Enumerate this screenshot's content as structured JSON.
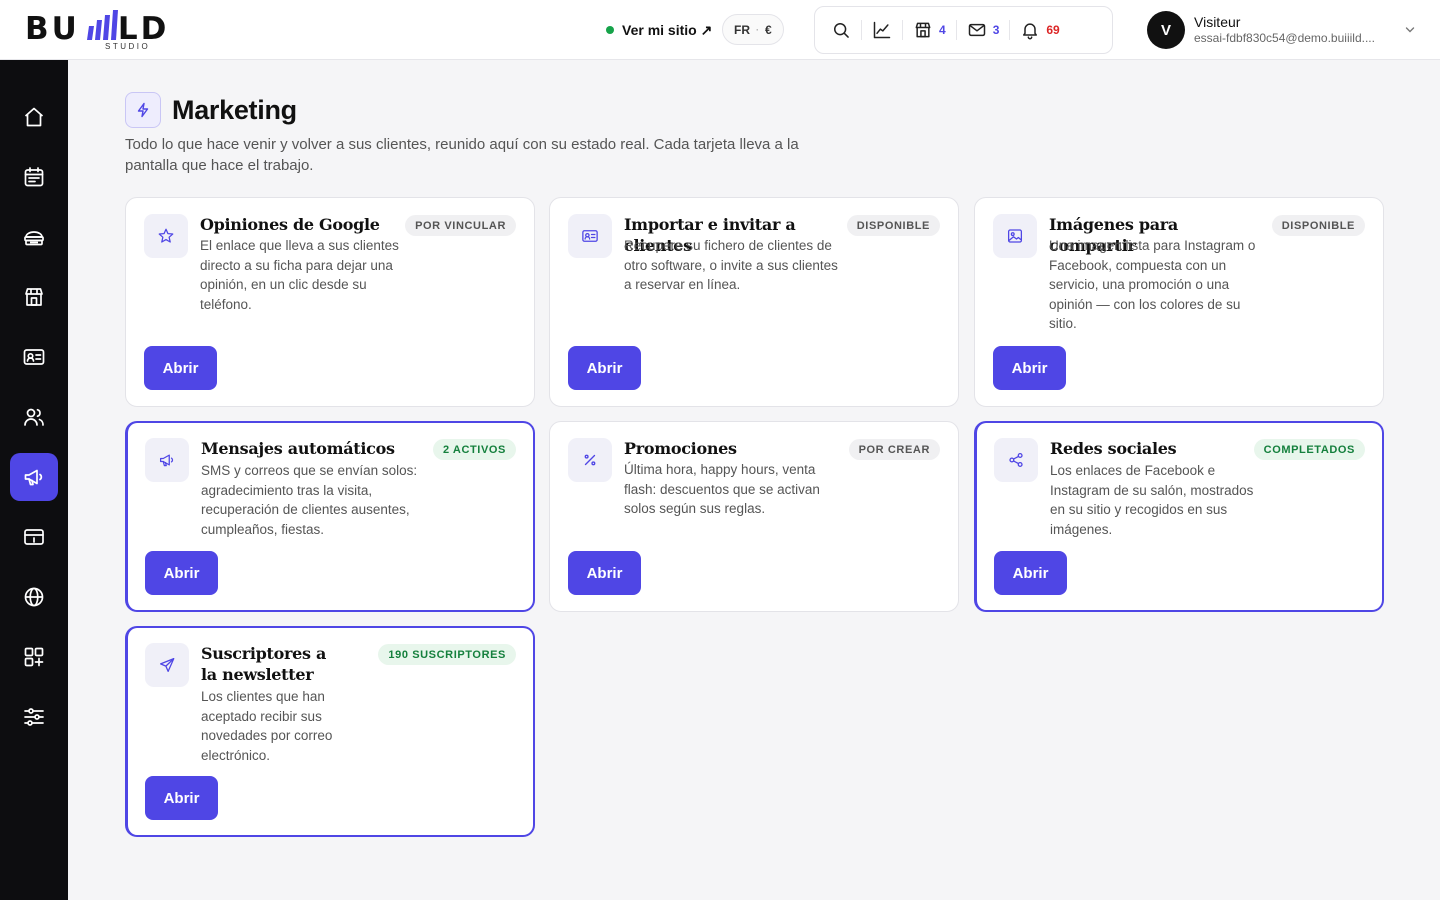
{
  "brand": {
    "name_left": "BU",
    "name_right": "LD",
    "sub": "STUDIO",
    "accent": "#4f46e5"
  },
  "header": {
    "site_link": "Ver mi sitio ↗",
    "lang": "FR",
    "currency": "€",
    "tools": [
      {
        "icon": "search-icon"
      },
      {
        "icon": "chart-icon"
      },
      {
        "icon": "store-icon",
        "count": "4"
      },
      {
        "icon": "mail-icon",
        "count": "3"
      },
      {
        "icon": "bell-icon",
        "count": "69"
      }
    ],
    "user": {
      "initial": "V",
      "name": "Visiteur",
      "email": "essai-fdbf830c54@demo.buiiild...."
    }
  },
  "sidebar": {
    "items": [
      {
        "icon": "home-icon"
      },
      {
        "icon": "calendar-icon"
      },
      {
        "icon": "services-icon"
      },
      {
        "icon": "store-icon"
      },
      {
        "icon": "id-card-icon"
      },
      {
        "icon": "users-icon"
      },
      {
        "icon": "megaphone-icon",
        "active": true
      },
      {
        "icon": "payment-icon"
      },
      {
        "icon": "globe-icon"
      },
      {
        "icon": "apps-icon"
      },
      {
        "icon": "settings-sliders-icon"
      }
    ]
  },
  "main": {
    "title": "Marketing",
    "description": "Todo lo que hace venir y volver a sus clientes, reunido aquí con su estado real. Cada tarjeta lleva a la pantalla que hace el trabajo.",
    "cards": [
      {
        "title": "Opiniones de Google",
        "badge": "POR VINCULAR",
        "description": "El enlace que lleva a sus clientes directo a su ficha para dejar una opinión, en un clic desde su teléfono.",
        "button": "Abrir",
        "icon": "star-icon"
      },
      {
        "title": "Importar e invitar a clientes",
        "badge": "DISPONIBLE",
        "description": "Recupere su fichero de clientes de otro software, o invite a sus clientes a reservar en línea.",
        "button": "Abrir",
        "icon": "contact-card-icon"
      },
      {
        "title": "Imágenes para compartir",
        "badge": "DISPONIBLE",
        "description": "Una imagen lista para Instagram o Facebook, compuesta con un servicio, una promoción o una opinión — con los colores de su sitio.",
        "button": "Abrir",
        "icon": "image-icon"
      },
      {
        "title": "Mensajes automáticos",
        "badge": "2 ACTIVOS",
        "description": "SMS y correos que se envían solos: agradecimiento tras la visita, recuperación de clientes ausentes, cumpleaños, fiestas.",
        "button": "Abrir",
        "icon": "megaphone-icon"
      },
      {
        "title": "Promociones",
        "badge": "POR CREAR",
        "description": "Última hora, happy hours, venta flash: descuentos que se activan solos según sus reglas.",
        "button": "Abrir",
        "icon": "percent-icon"
      },
      {
        "title": "Redes sociales",
        "badge": "COMPLETADOS",
        "description": "Los enlaces de Facebook e Instagram de su salón, mostrados en su sitio y recogidos en sus imágenes.",
        "button": "Abrir",
        "icon": "share-icon"
      },
      {
        "title": "Suscriptores a la newsletter",
        "badge": "190 SUSCRIPTORES",
        "description": "Los clientes que han aceptado recibir sus novedades por correo electrónico.",
        "button": "Abrir",
        "icon": "send-icon"
      }
    ]
  }
}
